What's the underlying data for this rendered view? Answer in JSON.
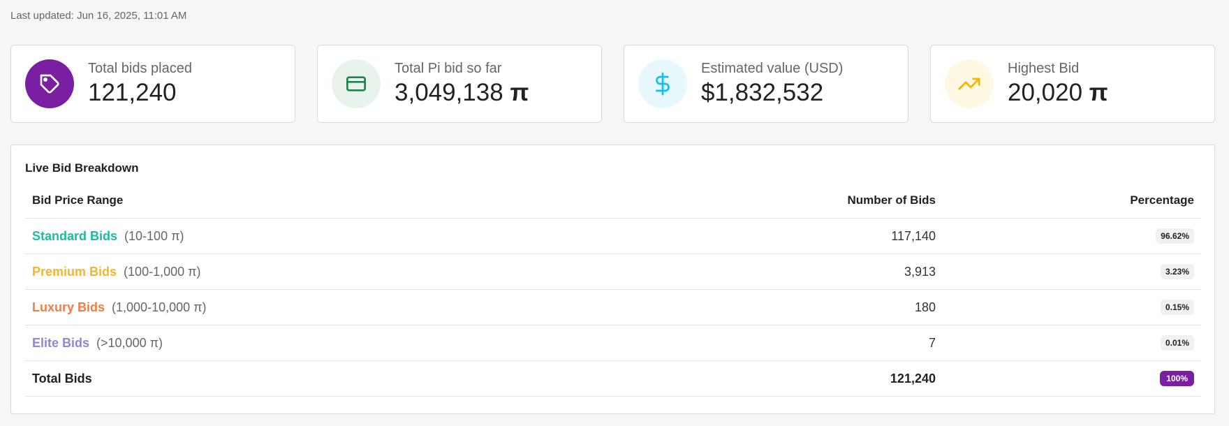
{
  "last_updated": "Last updated: Jun 16, 2025, 11:01 AM",
  "cards": [
    {
      "label": "Total bids placed",
      "value": "121,240",
      "icon": "tag-icon",
      "bg": "#7b1fa2",
      "fg": "#ffffff"
    },
    {
      "label": "Total Pi bid so far",
      "value": "3,049,138",
      "suffix": "π",
      "icon": "credit-card-icon",
      "bg": "#e8f3ec",
      "fg": "#1e8449"
    },
    {
      "label": "Estimated value (USD)",
      "value": "$1,832,532",
      "icon": "dollar-icon",
      "bg": "#e6f8fc",
      "fg": "#17c1e8"
    },
    {
      "label": "Highest Bid",
      "value": "20,020",
      "suffix": "π",
      "icon": "trending-up-icon",
      "bg": "#fff8e2",
      "fg": "#f5b800"
    }
  ],
  "breakdown": {
    "title": "Live Bid Breakdown",
    "headers": {
      "range": "Bid Price Range",
      "count": "Number of Bids",
      "pct": "Percentage"
    },
    "rows": [
      {
        "name": "Standard Bids",
        "range": "(10-100 π)",
        "count": "117,140",
        "pct": "96.62%",
        "color": "#1abc9c"
      },
      {
        "name": "Premium Bids",
        "range": "(100-1,000 π)",
        "count": "3,913",
        "pct": "3.23%",
        "color": "#f7b52c"
      },
      {
        "name": "Luxury Bids",
        "range": "(1,000-10,000 π)",
        "count": "180",
        "pct": "0.15%",
        "color": "#f07d43"
      },
      {
        "name": "Elite Bids",
        "range": "(>10,000 π)",
        "count": "7",
        "pct": "0.01%",
        "color": "#8e86d4"
      }
    ],
    "total": {
      "label": "Total Bids",
      "count": "121,240",
      "pct": "100%"
    }
  }
}
